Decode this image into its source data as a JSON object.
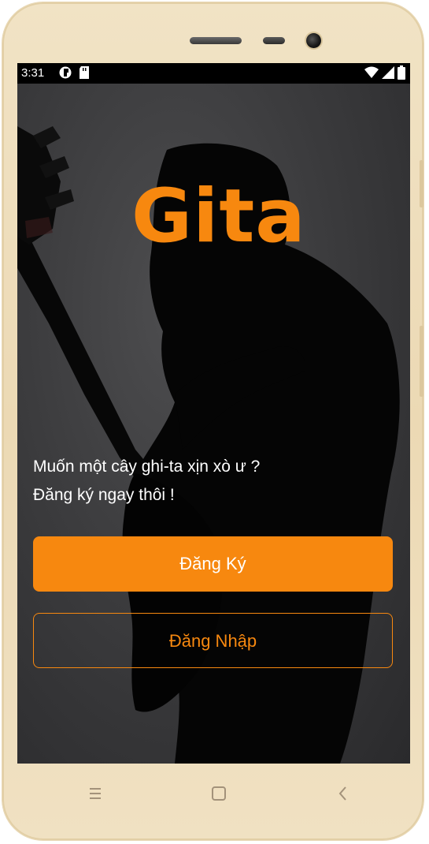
{
  "status_bar": {
    "time": "3:31",
    "left_icons": [
      "sync-icon",
      "sd-card-icon"
    ],
    "right_icons": [
      "wifi-icon",
      "signal-icon",
      "battery-icon"
    ]
  },
  "app": {
    "logo": "Gita",
    "tagline_line1": "Muốn một cây ghi-ta xịn xò ư ?",
    "tagline_line2": "Đăng ký ngay thôi !",
    "register_label": "Đăng Ký",
    "login_label": "Đăng Nhập"
  },
  "nav_bar": {
    "items": [
      "menu-icon",
      "home-icon",
      "back-icon"
    ]
  },
  "colors": {
    "accent": "#f7880f",
    "phone_body": "#f0e2c4"
  }
}
